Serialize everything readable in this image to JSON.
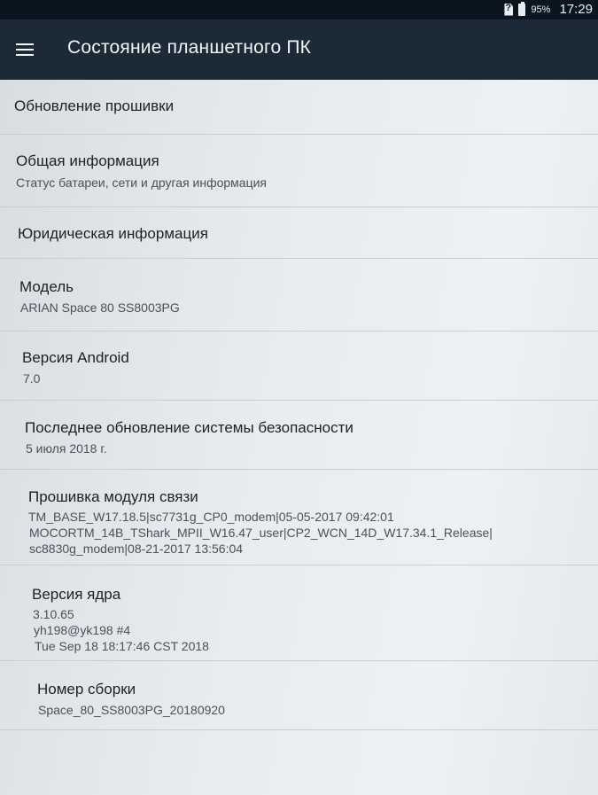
{
  "status_bar": {
    "battery_percent": "95%",
    "time": "17:29",
    "icons": [
      "sim-unknown-icon",
      "battery-icon"
    ]
  },
  "app_bar": {
    "title": "Состояние планшетного ПК",
    "menu_icon": "hamburger-menu-icon"
  },
  "items": [
    {
      "title": "Обновление прошивки"
    },
    {
      "title": "Общая информация",
      "subtitle": "Статус батареи, сети и другая информация"
    },
    {
      "title": "Юридическая информация"
    },
    {
      "title": "Модель",
      "subtitle": "ARIAN Space 80 SS8003PG"
    },
    {
      "title": "Версия Android",
      "subtitle": "7.0"
    },
    {
      "title": "Последнее обновление системы безопасности",
      "subtitle": "5 июля 2018 г."
    },
    {
      "title": "Прошивка модуля связи",
      "lines": [
        "TM_BASE_W17.18.5|sc7731g_CP0_modem|05-05-2017 09:42:01",
        "MOCORTM_14B_TShark_MPII_W16.47_user|CP2_WCN_14D_W17.34.1_Release|",
        "sc8830g_modem|08-21-2017 13:56:04"
      ]
    },
    {
      "title": "Версия ядра",
      "lines": [
        "3.10.65",
        "yh198@yk198 #4",
        "Tue Sep 18 18:17:46 CST 2018"
      ]
    },
    {
      "title": "Номер сборки",
      "subtitle": "Space_80_SS8003PG_20180920"
    }
  ]
}
